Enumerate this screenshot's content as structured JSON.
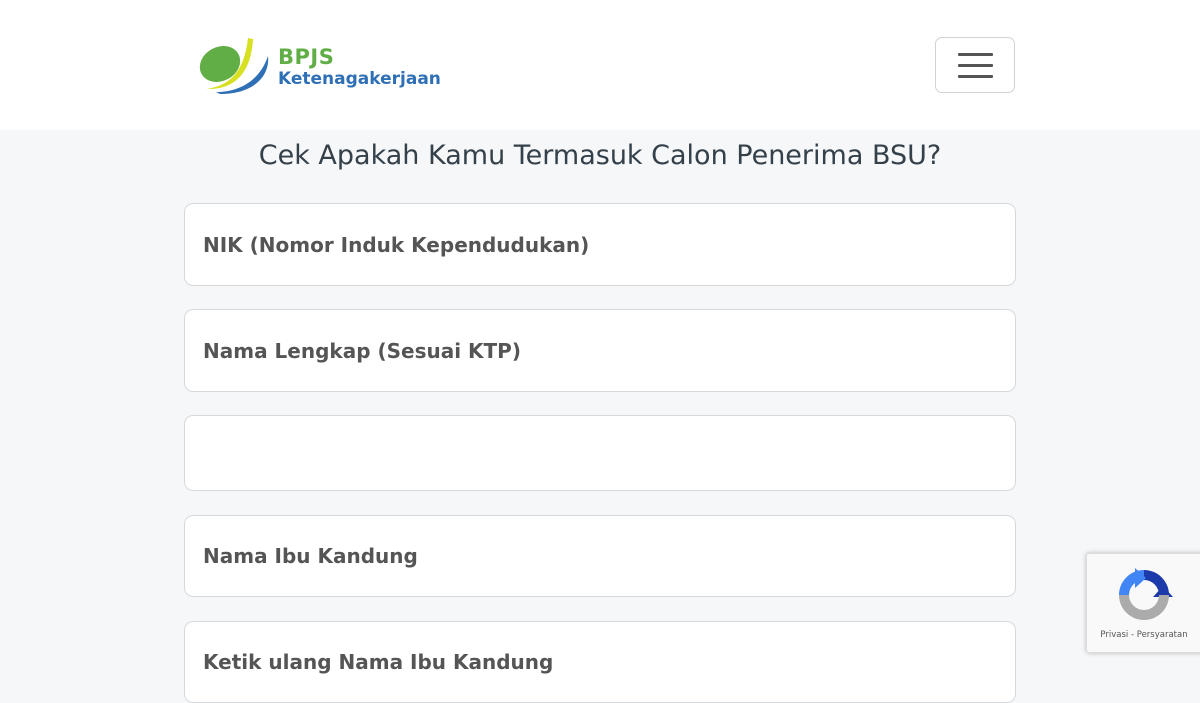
{
  "header": {
    "logo": {
      "brand": "BPJS",
      "subtitle": "Ketenagakerjaan",
      "icon": "bpjs-leaf-logo",
      "colors": {
        "green": "#61ae46",
        "blue": "#2f6fb5",
        "yellow": "#d8e022"
      }
    },
    "menu_icon": "hamburger-icon"
  },
  "main": {
    "title": "Cek Apakah Kamu Termasuk Calon Penerima BSU?",
    "fields": [
      {
        "placeholder": "NIK (Nomor Induk Kependudukan)",
        "value": ""
      },
      {
        "placeholder": "Nama Lengkap (Sesuai KTP)",
        "value": ""
      },
      {
        "placeholder": "",
        "value": ""
      },
      {
        "placeholder": "Nama Ibu Kandung",
        "value": ""
      },
      {
        "placeholder": "Ketik ulang Nama Ibu Kandung",
        "value": ""
      }
    ]
  },
  "recaptcha": {
    "icon": "recaptcha-icon",
    "privacy": "Privasi",
    "separator": "-",
    "terms": "Persyaratan"
  }
}
